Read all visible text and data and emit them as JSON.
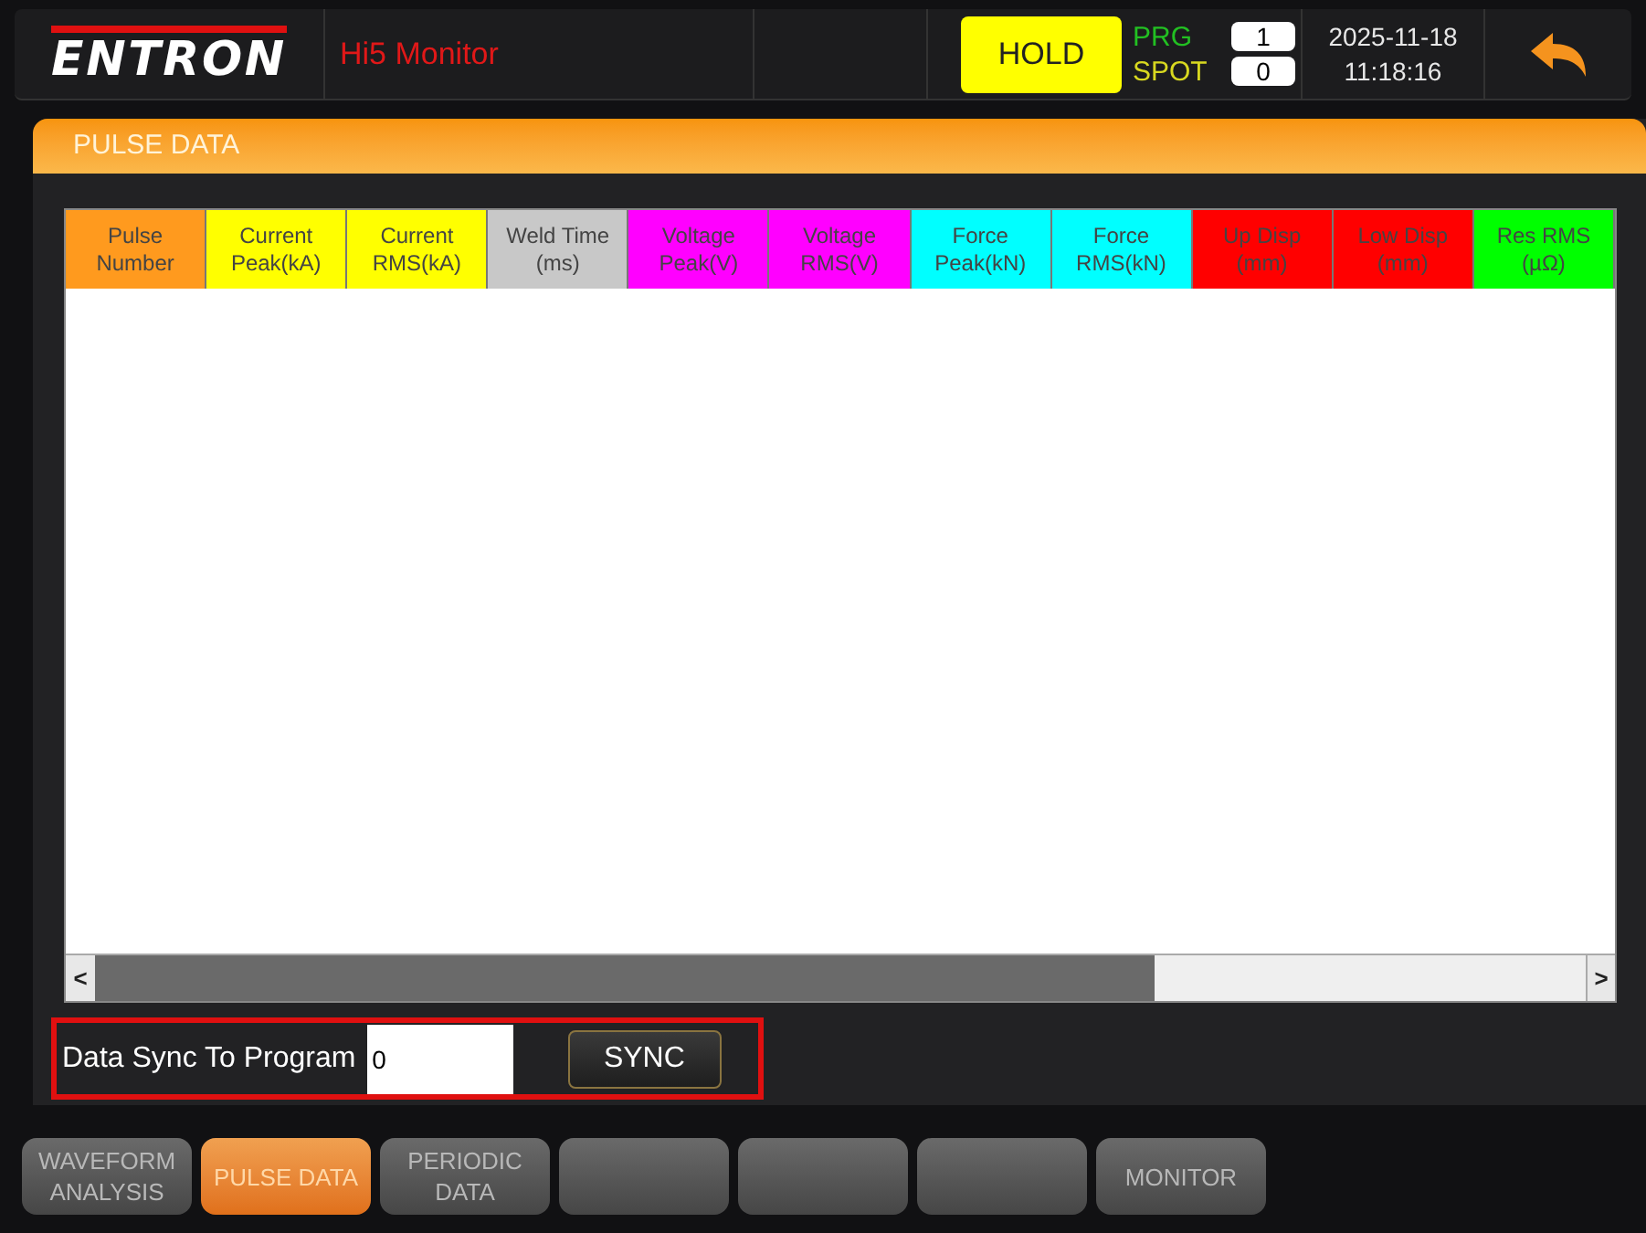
{
  "header": {
    "logo": "ENTRON",
    "app_title": "Hi5 Monitor",
    "status": "HOLD",
    "program_label": "PRG",
    "program_value": "1",
    "spot_label": "SPOT",
    "spot_value": "0",
    "date": "2025-11-18",
    "time": "11:18:16"
  },
  "panel": {
    "title": "PULSE DATA"
  },
  "table": {
    "columns": [
      {
        "label": "Pulse Number",
        "color": "#ff9a1e"
      },
      {
        "label": "Current Peak(kA)",
        "color": "#ffff00"
      },
      {
        "label": "Current RMS(kA)",
        "color": "#ffff00"
      },
      {
        "label": "Weld Time (ms)",
        "color": "#c8c8c8"
      },
      {
        "label": "Voltage Peak(V)",
        "color": "#ff00ff"
      },
      {
        "label": "Voltage RMS(V)",
        "color": "#ff00ff"
      },
      {
        "label": "Force Peak(kN)",
        "color": "#00ffff"
      },
      {
        "label": "Force RMS(kN)",
        "color": "#00ffff"
      },
      {
        "label": "Up Disp (mm)",
        "color": "#ff0000"
      },
      {
        "label": "Low Disp (mm)",
        "color": "#ff0000"
      },
      {
        "label": "Res RMS (µΩ)",
        "color": "#00ff00"
      }
    ]
  },
  "scrollbar": {
    "left": "<",
    "right": ">"
  },
  "sync": {
    "label": "Data Sync To Program",
    "value": "0",
    "button": "SYNC"
  },
  "nav": [
    {
      "label": "WAVEFORM ANALYSIS",
      "selected": false
    },
    {
      "label": "PULSE DATA",
      "selected": true
    },
    {
      "label": "PERIODIC DATA",
      "selected": false
    },
    {
      "selected": false
    },
    {
      "selected": false
    },
    {
      "selected": false
    },
    {
      "label": "MONITOR",
      "selected": false
    }
  ]
}
